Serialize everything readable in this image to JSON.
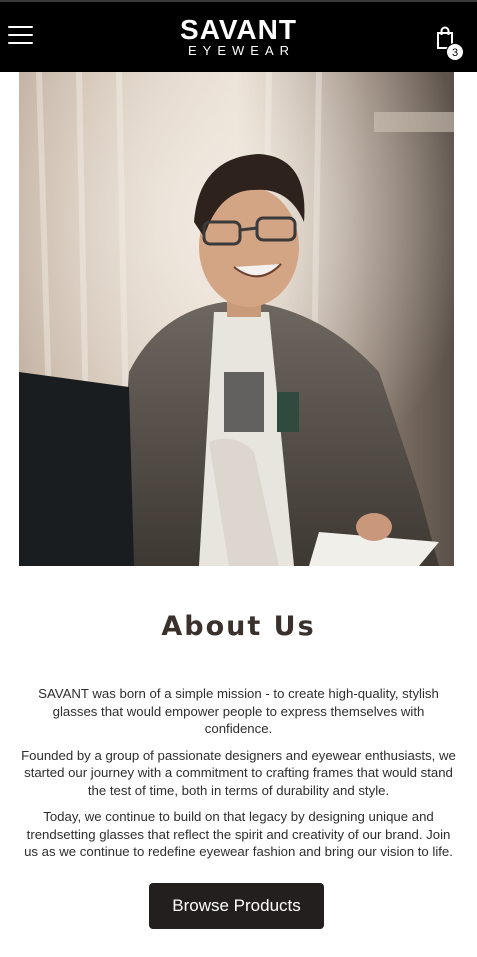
{
  "header": {
    "logo_main": "SAVANT",
    "logo_sub": "EYEWEAR",
    "cart_count": "3",
    "menu_icon": "hamburger-menu-icon",
    "cart_icon": "shopping-bag-icon"
  },
  "about": {
    "title": "About Us",
    "paragraphs": [
      "SAVANT was born of a simple mission - to create high-quality, stylish glasses that would empower people to express themselves with confidence.",
      "Founded by a group of passionate designers and eyewear enthusiasts, we started our journey with a commitment to crafting frames that would stand the test of time, both in terms of durability and style.",
      "Today, we continue to build on that legacy by designing unique and trendsetting glasses that reflect the spirit and creativity of our brand. Join us as we continue to redefine eyewear fashion and bring our vision to life."
    ],
    "button_label": "Browse Products"
  },
  "colors": {
    "header_bg": "#000000",
    "button_bg": "#231f1f",
    "title_color": "#3a302c"
  }
}
